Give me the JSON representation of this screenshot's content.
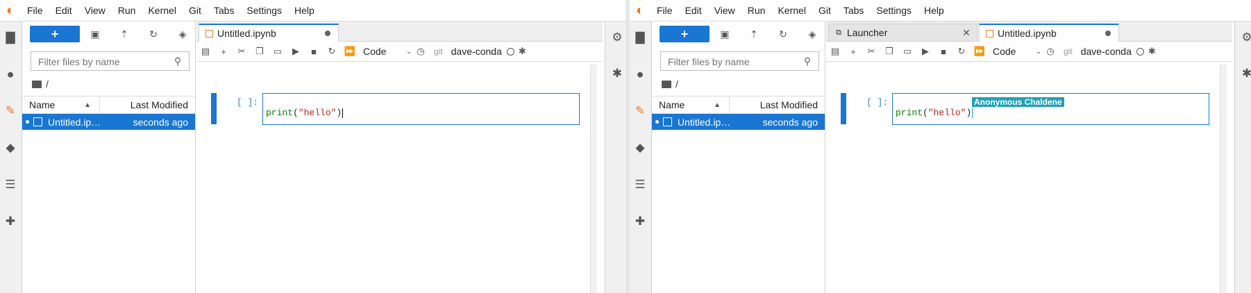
{
  "menu": [
    "File",
    "Edit",
    "View",
    "Run",
    "Kernel",
    "Git",
    "Tabs",
    "Settings",
    "Help"
  ],
  "filebrowser": {
    "new_label": "+",
    "filter_placeholder": "Filter files by name",
    "breadcrumb": "/",
    "col_name": "Name",
    "col_modified": "Last Modified",
    "files": [
      {
        "name": "Untitled.ip…",
        "modified": "seconds ago"
      }
    ]
  },
  "left": {
    "tabs": [
      {
        "label": "Untitled.ipynb"
      }
    ]
  },
  "right": {
    "tabs": [
      {
        "label": "Launcher"
      },
      {
        "label": "Untitled.ipynb"
      }
    ],
    "collaborator": "Anonymous Chaldene"
  },
  "notebook": {
    "cell_type": "Code",
    "git_label": "git",
    "kernel": "dave-conda",
    "prompt": "[ ]:",
    "code_fn": "print",
    "code_open": "(",
    "code_str": "\"hello\"",
    "code_close": ")"
  },
  "colors": {
    "accent": "#1976d2",
    "collaborator": "#1fa2b7",
    "logo": "#f37726"
  }
}
